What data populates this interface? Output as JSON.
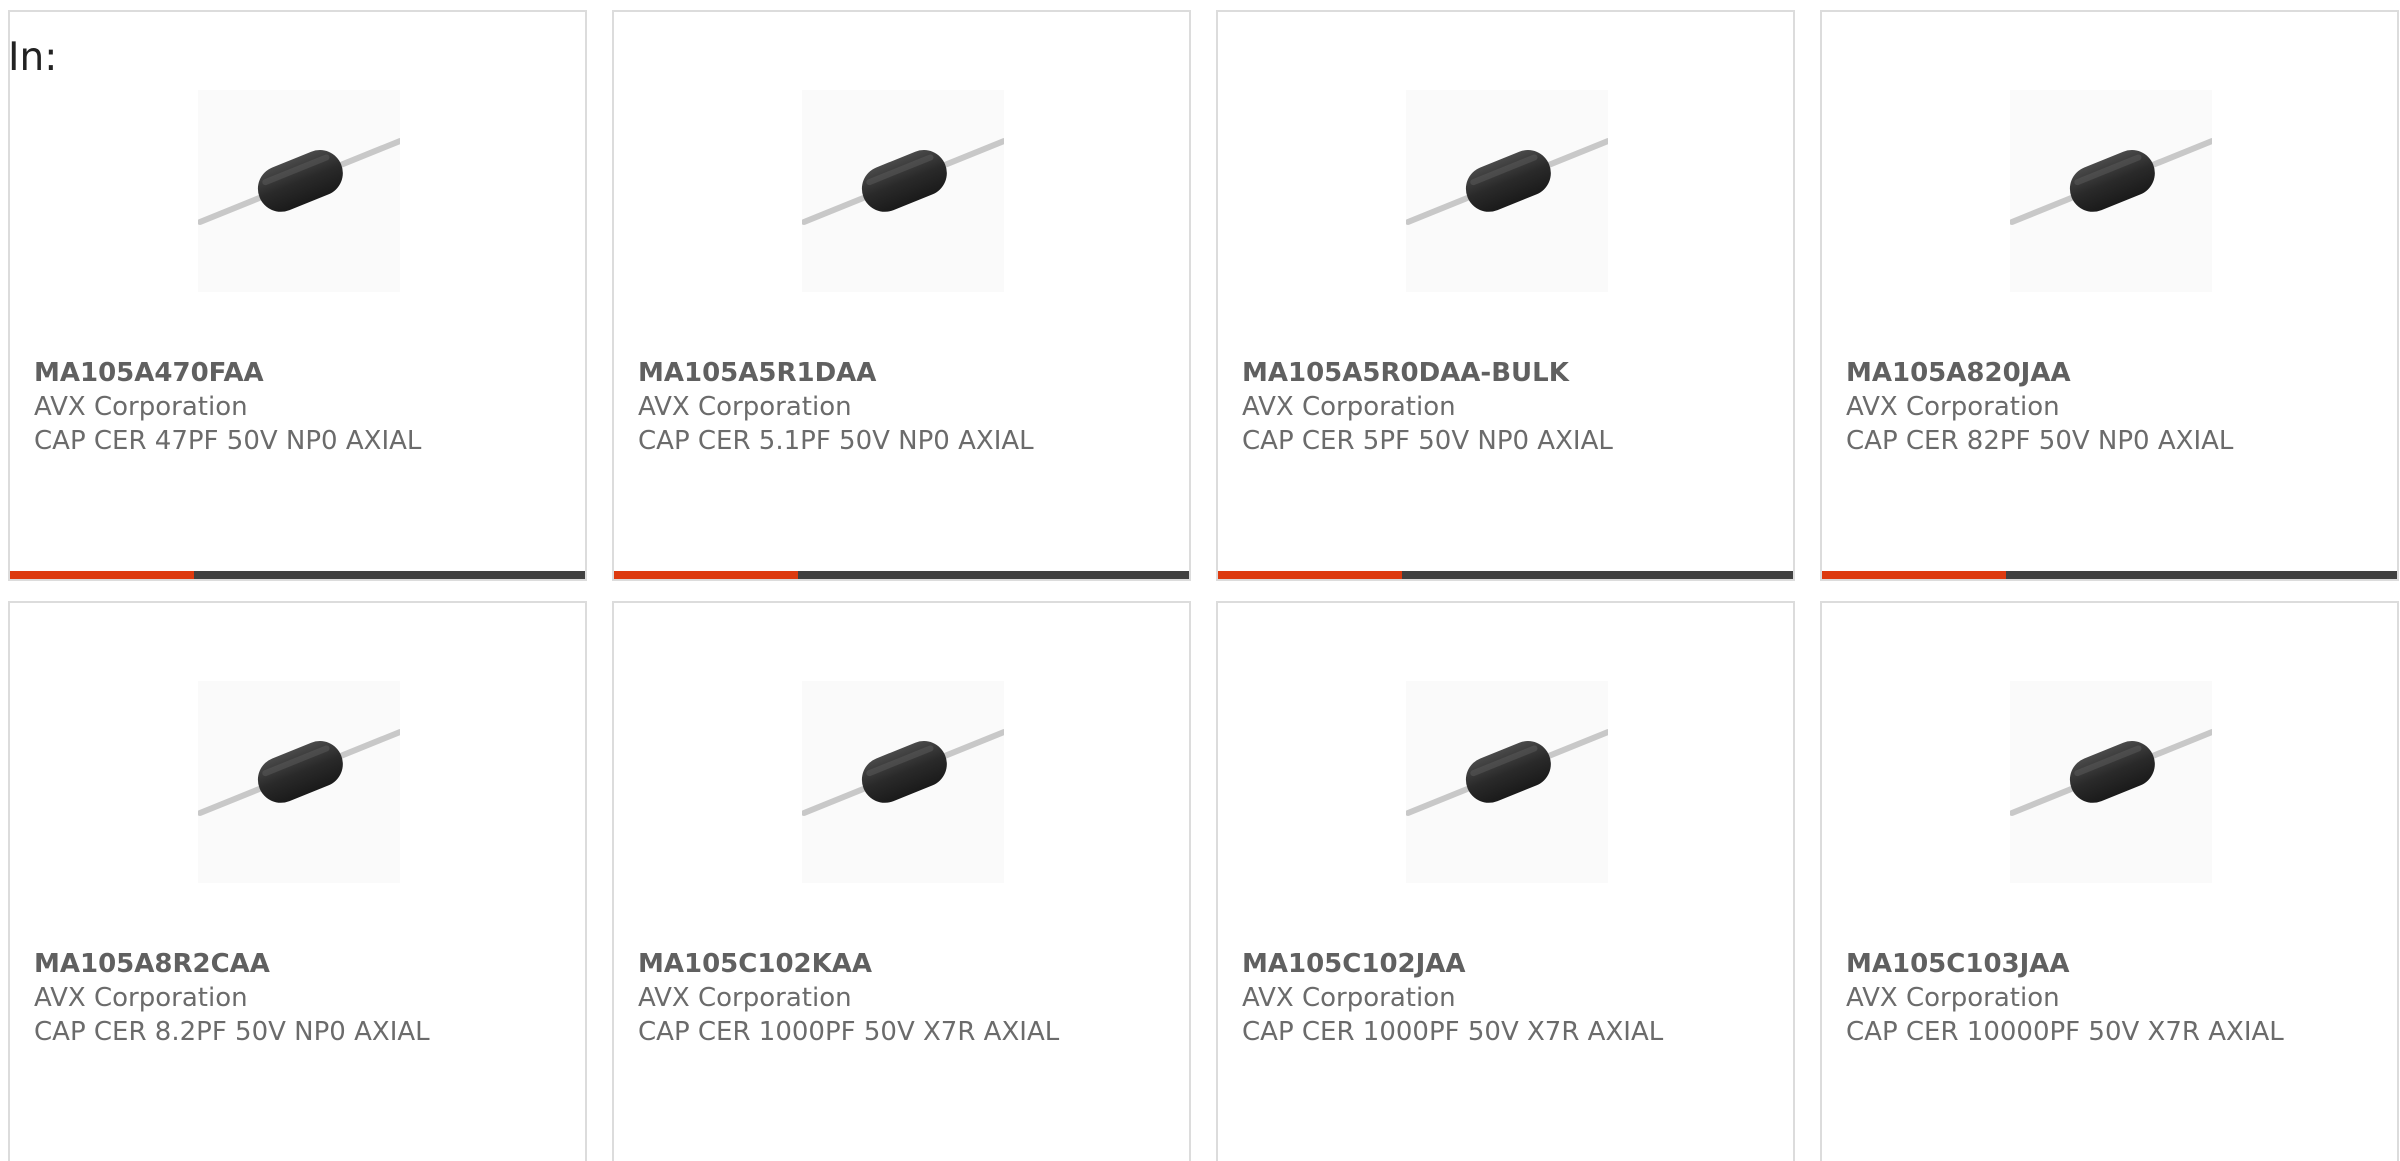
{
  "header": {
    "in_label": "In:"
  },
  "colors": {
    "progress_fill": "#dd3a0f",
    "progress_track": "#404040",
    "card_border": "#dcdcdc",
    "text": "#6b6b6b"
  },
  "products": [
    {
      "part_number": "MA105A470FAA",
      "manufacturer": "AVX Corporation",
      "description": "CAP CER 47PF 50V NP0 AXIAL",
      "image_icon": "axial-capacitor-icon",
      "progress_fraction": 0.32
    },
    {
      "part_number": "MA105A5R1DAA",
      "manufacturer": "AVX Corporation",
      "description": "CAP CER 5.1PF 50V NP0 AXIAL",
      "image_icon": "axial-capacitor-icon",
      "progress_fraction": 0.32
    },
    {
      "part_number": "MA105A5R0DAA-BULK",
      "manufacturer": "AVX Corporation",
      "description": "CAP CER 5PF 50V NP0 AXIAL",
      "image_icon": "axial-capacitor-icon",
      "progress_fraction": 0.32
    },
    {
      "part_number": "MA105A820JAA",
      "manufacturer": "AVX Corporation",
      "description": "CAP CER 82PF 50V NP0 AXIAL",
      "image_icon": "axial-capacitor-icon",
      "progress_fraction": 0.32
    },
    {
      "part_number": "MA105A8R2CAA",
      "manufacturer": "AVX Corporation",
      "description": "CAP CER 8.2PF 50V NP0 AXIAL",
      "image_icon": "axial-capacitor-icon"
    },
    {
      "part_number": "MA105C102KAA",
      "manufacturer": "AVX Corporation",
      "description": "CAP CER 1000PF 50V X7R AXIAL",
      "image_icon": "axial-capacitor-icon"
    },
    {
      "part_number": "MA105C102JAA",
      "manufacturer": "AVX Corporation",
      "description": "CAP CER 1000PF 50V X7R AXIAL",
      "image_icon": "axial-capacitor-icon"
    },
    {
      "part_number": "MA105C103JAA",
      "manufacturer": "AVX Corporation",
      "description": "CAP CER 10000PF 50V X7R AXIAL",
      "image_icon": "axial-capacitor-icon"
    }
  ]
}
